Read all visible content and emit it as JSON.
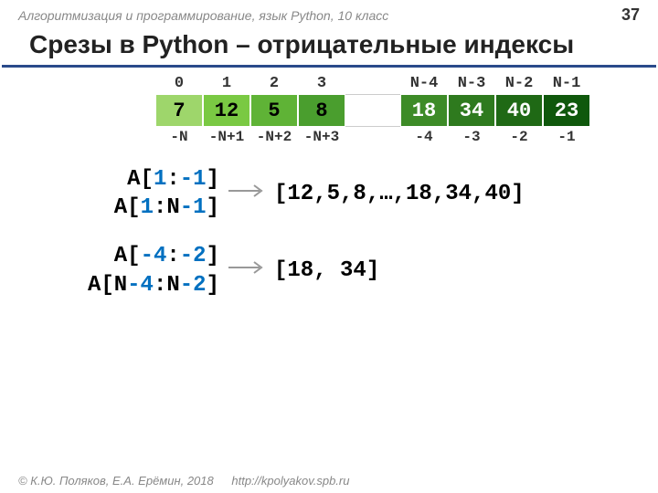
{
  "header": {
    "course": "Алгоритмизация и программирование, язык Python, 10 класс",
    "page": "37"
  },
  "title": "Срезы в Python – отрицательные индексы",
  "top_idx": [
    "0",
    "1",
    "2",
    "3",
    "N-4",
    "N-3",
    "N-2",
    "N-1"
  ],
  "arr": [
    "7",
    "12",
    "5",
    "8",
    "18",
    "34",
    "40",
    "23"
  ],
  "bot_idx": [
    "-N",
    "-N+1",
    "-N+2",
    "-N+3",
    "-4",
    "-3",
    "-2",
    "-1"
  ],
  "ex1": {
    "a_pre": "A[",
    "a_i1": "1",
    "a_mid": ":",
    "a_i2": "-1",
    "a_suf": "]",
    "b_pre": "A[",
    "b_i1": "1",
    "b_mid": ":N",
    "b_i2": "-1",
    "b_suf": "]",
    "result": "[12,5,8,…,18,34,40]"
  },
  "ex2": {
    "a_pre": "A[",
    "a_i1": "-4",
    "a_mid": ":",
    "a_i2": "-2",
    "a_suf": "]",
    "b_pre": "A[N",
    "b_i1": "-4",
    "b_mid": ":N",
    "b_i2": "-2",
    "b_suf": "]",
    "result": "[18, 34]"
  },
  "footer": {
    "copyright": "© К.Ю. Поляков, Е.А. Ерёмин, 2018",
    "url": "http://kpolyakov.spb.ru"
  }
}
